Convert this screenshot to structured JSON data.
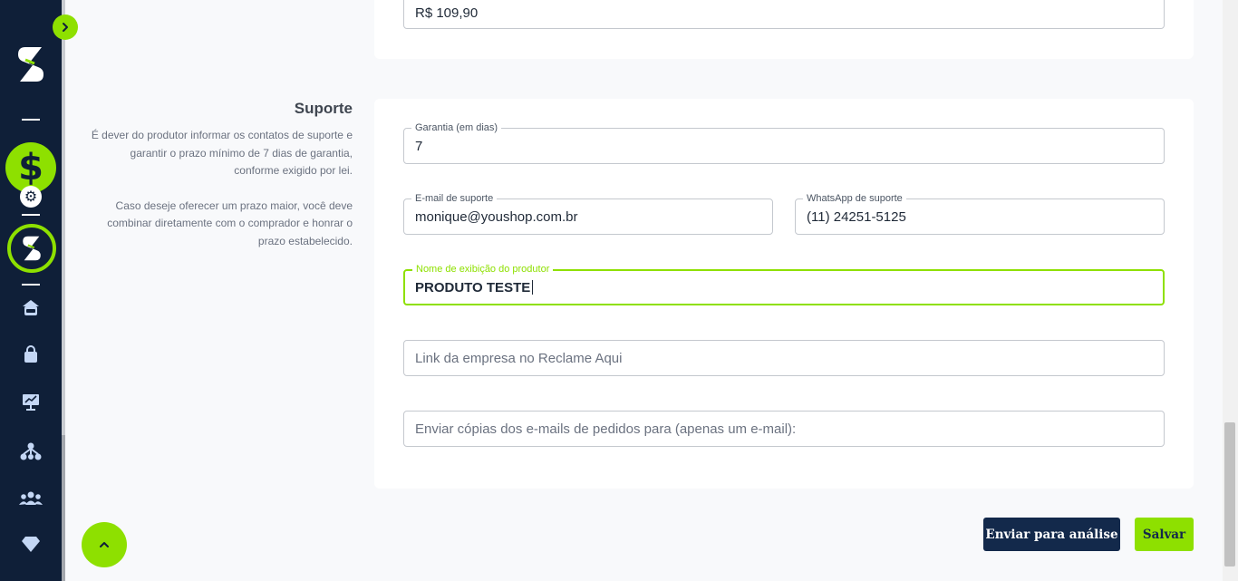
{
  "sidebar": {
    "toggle_icon": "chevron-right-icon",
    "logo_icon": "brand-s-logo",
    "dollar_glyph": "$",
    "settings_icon": "gear-icon",
    "app_icon": "brand-s-logo",
    "nav_icons": [
      "shop-icon",
      "bag-icon",
      "presentation-chart-icon",
      "network-icon",
      "users-icon",
      "diamond-icon"
    ]
  },
  "price_field": {
    "value": "R$ 109,90"
  },
  "support": {
    "title": "Suporte",
    "description_1": "É dever do produtor informar os contatos de suporte e garantir o prazo mínimo de 7 dias de garantia, conforme exigido por lei.",
    "description_2": "Caso deseje oferecer um prazo maior, você deve combinar diretamente com o comprador e honrar o prazo estabelecido.",
    "guarantee": {
      "label": "Garantia (em dias)",
      "value": "7"
    },
    "email": {
      "label": "E-mail de suporte",
      "value": "monique@youshop.com.br"
    },
    "whatsapp": {
      "label": "WhatsApp de suporte",
      "value": "(11) 24251-5125"
    },
    "producer_name": {
      "label": "Nome de exibição do produtor",
      "value": "PRODUTO TESTE"
    },
    "reclame_aqui": {
      "placeholder": "Link da empresa no Reclame Aqui"
    },
    "copy_emails": {
      "placeholder": "Enviar cópias dos e-mails de pedidos para (apenas um e-mail):"
    }
  },
  "actions": {
    "submit_label": "Enviar para análise",
    "save_label": "Salvar",
    "scroll_top_icon": "chevron-up-icon"
  },
  "colors": {
    "accent": "#8ee000",
    "sidebar_bg": "#0f1f38",
    "primary_button": "#13294b"
  }
}
